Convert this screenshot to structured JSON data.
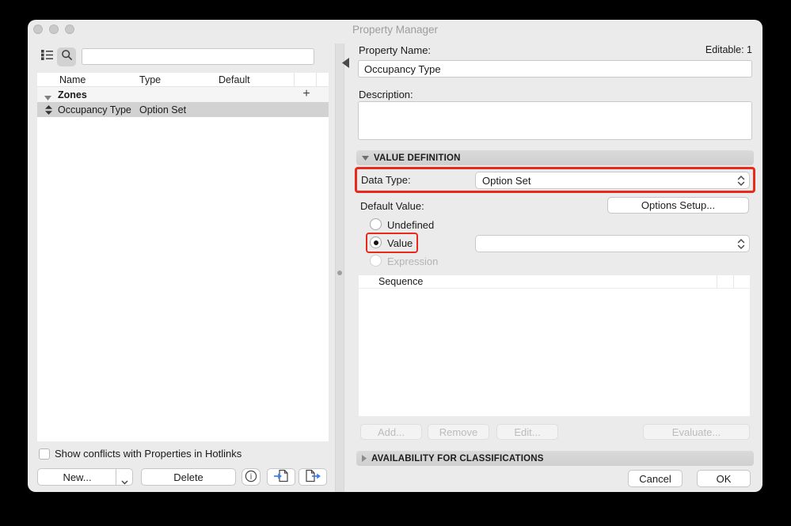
{
  "window": {
    "title": "Property Manager"
  },
  "left_panel": {
    "search": {
      "value": ""
    },
    "table": {
      "headers": [
        "Name",
        "Type",
        "Default"
      ],
      "group_row": {
        "name": "Zones",
        "add_button": "+"
      },
      "rows": [
        {
          "name": "Occupancy Type",
          "type": "Option Set",
          "default": "",
          "selected": true
        }
      ]
    },
    "hotlinks_checkbox": {
      "label": "Show conflicts with Properties in Hotlinks",
      "checked": false
    },
    "footer": {
      "new_button": "New...",
      "delete_button": "Delete"
    }
  },
  "right_panel": {
    "editable_count": "Editable: 1",
    "property_name": {
      "label": "Property Name:",
      "value": "Occupancy Type"
    },
    "description": {
      "label": "Description:",
      "value": ""
    },
    "value_definition": {
      "header": "VALUE DEFINITION",
      "data_type": {
        "label": "Data Type:",
        "value": "Option Set"
      },
      "default_value_label": "Default Value:",
      "options_setup_button": "Options Setup...",
      "radio_undefined": "Undefined",
      "radio_value": "Value",
      "radio_expression": "Expression",
      "value_dropdown_value": "",
      "sequence": {
        "header": "Sequence"
      },
      "add_button": "Add...",
      "remove_button": "Remove",
      "edit_button": "Edit...",
      "evaluate_button": "Evaluate..."
    },
    "availability": {
      "header": "AVAILABILITY FOR CLASSIFICATIONS"
    },
    "footer": {
      "cancel_button": "Cancel",
      "ok_button": "OK"
    }
  },
  "colors": {
    "annotation_red": "#e8291c",
    "icon_blue": "#3a7bf0",
    "window_bg": "#ebebeb",
    "selected_row": "#d2d2d2"
  }
}
